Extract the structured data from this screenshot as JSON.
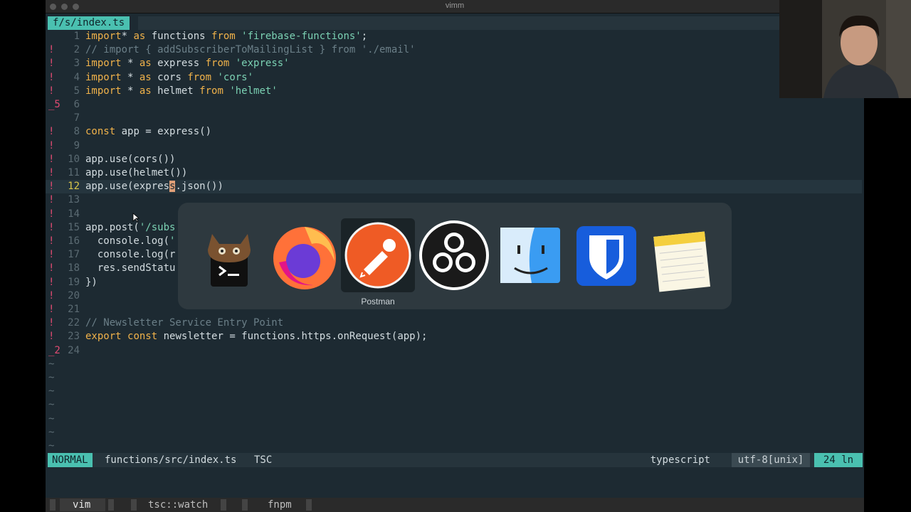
{
  "window": {
    "title": "vimm"
  },
  "buffer_tab": "f/s/index.ts",
  "lines": [
    {
      "n": "1",
      "sign": "",
      "segs": [
        [
          "kw",
          "import"
        ],
        [
          "",
          "* "
        ],
        [
          "kw",
          "as"
        ],
        [
          "",
          " functions "
        ],
        [
          "kw",
          "from"
        ],
        [
          "",
          ""
        ],
        [
          "st",
          " 'firebase-functions'"
        ],
        [
          "",
          ";"
        ]
      ]
    },
    {
      "n": "2",
      "sign": "!",
      "segs": [
        [
          "cm",
          "// import { addSubscriberToMailingList } from './email'"
        ]
      ]
    },
    {
      "n": "3",
      "sign": "!",
      "segs": [
        [
          "kw",
          "import"
        ],
        [
          "",
          " * "
        ],
        [
          "kw",
          "as"
        ],
        [
          "",
          " express "
        ],
        [
          "kw",
          "from"
        ],
        [
          "st",
          " 'express'"
        ]
      ]
    },
    {
      "n": "4",
      "sign": "!",
      "segs": [
        [
          "kw",
          "import"
        ],
        [
          "",
          " * "
        ],
        [
          "kw",
          "as"
        ],
        [
          "",
          " cors "
        ],
        [
          "kw",
          "from"
        ],
        [
          "st",
          " 'cors'"
        ]
      ]
    },
    {
      "n": "5",
      "sign": "!",
      "segs": [
        [
          "kw",
          "import"
        ],
        [
          "",
          " * "
        ],
        [
          "kw",
          "as"
        ],
        [
          "",
          " helmet "
        ],
        [
          "kw",
          "from"
        ],
        [
          "st",
          " 'helmet'"
        ]
      ]
    },
    {
      "n": "6",
      "sign": "_5",
      "segs": []
    },
    {
      "n": "7",
      "sign": "",
      "segs": []
    },
    {
      "n": "8",
      "sign": "!",
      "segs": [
        [
          "kw",
          "const"
        ],
        [
          "",
          " app = express()"
        ]
      ]
    },
    {
      "n": "9",
      "sign": "!",
      "segs": []
    },
    {
      "n": "10",
      "sign": "!",
      "segs": [
        [
          "",
          "app.use(cors())"
        ]
      ]
    },
    {
      "n": "11",
      "sign": "!",
      "segs": [
        [
          "",
          "app.use(helmet())"
        ]
      ]
    },
    {
      "n": "12",
      "sign": "!",
      "segs": [
        [
          "",
          "app.use(expres"
        ],
        [
          "cursor",
          "s"
        ],
        [
          "",
          ".json())"
        ]
      ]
    },
    {
      "n": "13",
      "sign": "!",
      "segs": []
    },
    {
      "n": "14",
      "sign": "!",
      "segs": []
    },
    {
      "n": "15",
      "sign": "!",
      "segs": [
        [
          "",
          "app.post("
        ],
        [
          "st",
          "'/subs"
        ]
      ]
    },
    {
      "n": "16",
      "sign": "!",
      "segs": [
        [
          "",
          "  console.log("
        ],
        [
          "st",
          "'"
        ]
      ]
    },
    {
      "n": "17",
      "sign": "!",
      "segs": [
        [
          "",
          "  console.log(r"
        ]
      ]
    },
    {
      "n": "18",
      "sign": "!",
      "segs": [
        [
          "",
          "  res.sendStatu"
        ]
      ]
    },
    {
      "n": "19",
      "sign": "!",
      "segs": [
        [
          "",
          "})"
        ]
      ]
    },
    {
      "n": "20",
      "sign": "!",
      "segs": []
    },
    {
      "n": "21",
      "sign": "!",
      "segs": []
    },
    {
      "n": "22",
      "sign": "!",
      "segs": [
        [
          "cm",
          "// Newsletter Service Entry Point"
        ]
      ]
    },
    {
      "n": "23",
      "sign": "!",
      "segs": [
        [
          "kw",
          "export"
        ],
        [
          "",
          " "
        ],
        [
          "kw",
          "const"
        ],
        [
          "",
          " newsletter = functions.https.onRequest(app);"
        ]
      ]
    },
    {
      "n": "24",
      "sign": "_2",
      "segs": []
    }
  ],
  "current_line": "12",
  "tilde": "~",
  "status": {
    "mode": "NORMAL",
    "file": "functions/src/index.ts",
    "tsc": "TSC",
    "filetype": "typescript",
    "encoding": "utf-8[unix]",
    "line_count": "24 ln"
  },
  "tmux": {
    "tabs": [
      "vim",
      "tsc::watch",
      "fnpm"
    ],
    "active": "vim"
  },
  "app_switcher": {
    "apps": [
      {
        "name": "Terminal (cat)",
        "icon": "terminal-cat-icon"
      },
      {
        "name": "Firefox",
        "icon": "firefox-icon"
      },
      {
        "name": "Postman",
        "icon": "postman-icon"
      },
      {
        "name": "OBS",
        "icon": "obs-icon"
      },
      {
        "name": "Finder",
        "icon": "finder-icon"
      },
      {
        "name": "Bitwarden",
        "icon": "bitwarden-icon"
      },
      {
        "name": "Notes",
        "icon": "notes-icon"
      }
    ],
    "selected_label": "Postman"
  }
}
